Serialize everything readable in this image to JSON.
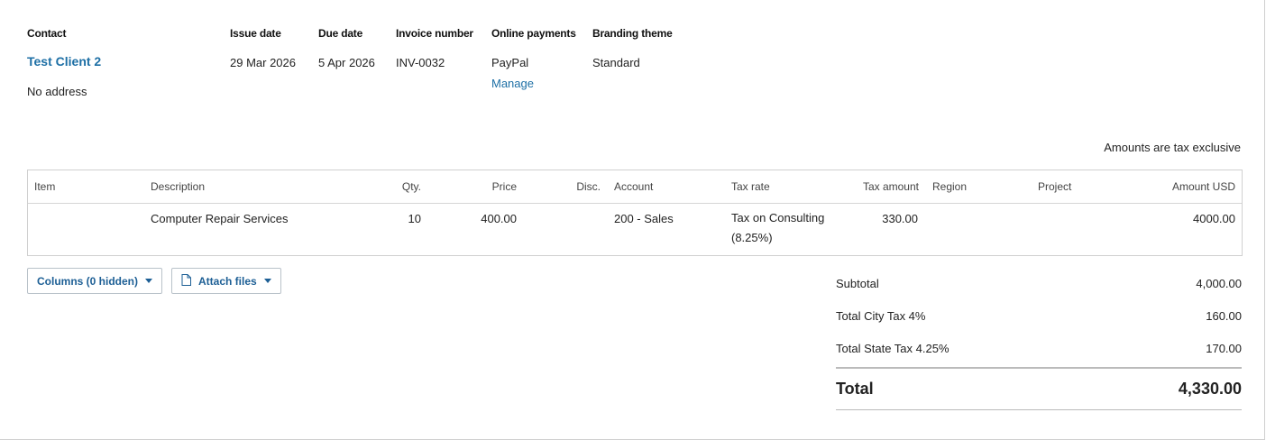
{
  "meta": {
    "contact": {
      "label": "Contact",
      "name": "Test Client 2",
      "address": "No address"
    },
    "issue_date": {
      "label": "Issue date",
      "value": "29 Mar 2026"
    },
    "due_date": {
      "label": "Due date",
      "value": "5 Apr 2026"
    },
    "invoice_number": {
      "label": "Invoice number",
      "value": "INV-0032"
    },
    "online_payments": {
      "label": "Online payments",
      "value": "PayPal",
      "manage_link": "Manage"
    },
    "branding_theme": {
      "label": "Branding theme",
      "value": "Standard"
    }
  },
  "tax_mode": "Amounts are tax exclusive",
  "table": {
    "headers": {
      "item": "Item",
      "description": "Description",
      "qty": "Qty.",
      "price": "Price",
      "disc": "Disc.",
      "account": "Account",
      "tax_rate": "Tax rate",
      "tax_amount": "Tax amount",
      "region": "Region",
      "project": "Project",
      "amount": "Amount USD"
    },
    "rows": [
      {
        "item": "",
        "description": "Computer Repair Services",
        "qty": "10",
        "price": "400.00",
        "disc": "",
        "account": "200 - Sales",
        "tax_rate": "Tax on Consulting (8.25%)",
        "tax_amount": "330.00",
        "region": "",
        "project": "",
        "amount": "4000.00"
      }
    ]
  },
  "buttons": {
    "columns": "Columns (0 hidden)",
    "attach": "Attach files"
  },
  "totals": {
    "subtotal": {
      "label": "Subtotal",
      "value": "4,000.00"
    },
    "city_tax": {
      "label": "Total City Tax 4%",
      "value": "160.00"
    },
    "state_tax": {
      "label": "Total State Tax 4.25%",
      "value": "170.00"
    },
    "total": {
      "label": "Total",
      "value": "4,330.00"
    }
  },
  "colors": {
    "link": "#1d6fa5",
    "button_text": "#1d5f95",
    "border": "#d0d0d0"
  },
  "icons": {
    "attach": "document-icon",
    "dropdown": "caret-down-icon"
  }
}
